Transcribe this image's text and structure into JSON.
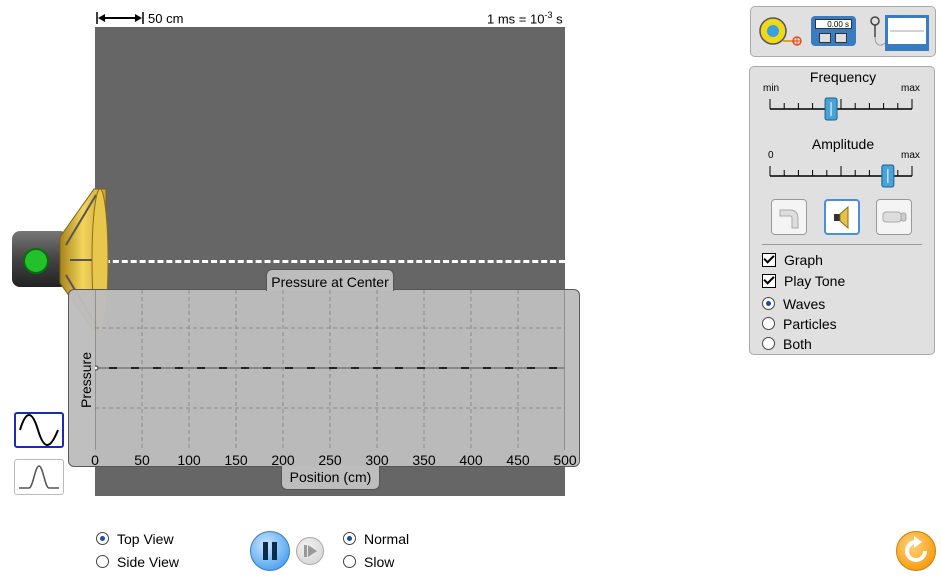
{
  "scale": {
    "length_label": "50 cm",
    "time_label_prefix": "1 ms = 10",
    "time_label_exp": "-3",
    "time_label_suffix": " s"
  },
  "graph": {
    "title": "Pressure at Center",
    "y_label": "Pressure",
    "x_label": "Position (cm)",
    "x_ticks": [
      "0",
      "50",
      "100",
      "150",
      "200",
      "250",
      "300",
      "350",
      "400",
      "450",
      "500"
    ]
  },
  "tools": {
    "stopwatch_reading": "0.00 s"
  },
  "controls": {
    "frequency": {
      "title": "Frequency",
      "min_label": "min",
      "max_label": "max",
      "value": 0.43
    },
    "amplitude": {
      "title": "Amplitude",
      "min_label": "0",
      "max_label": "max",
      "value": 0.83
    },
    "checkboxes": [
      {
        "label": "Graph",
        "checked": true
      },
      {
        "label": "Play Tone",
        "checked": true
      }
    ],
    "view_radios": [
      {
        "label": "Waves",
        "selected": true
      },
      {
        "label": "Particles",
        "selected": false
      },
      {
        "label": "Both",
        "selected": false
      }
    ]
  },
  "bottom": {
    "view_options": [
      {
        "label": "Top View",
        "selected": true
      },
      {
        "label": "Side View",
        "selected": false
      }
    ],
    "speed_options": [
      {
        "label": "Normal",
        "selected": true
      },
      {
        "label": "Slow",
        "selected": false
      }
    ]
  },
  "colors": {
    "accent": "#58a9f0",
    "reset": "#f7a11a",
    "wave_area": "#666666",
    "selected_border": "#1c2bb0"
  }
}
